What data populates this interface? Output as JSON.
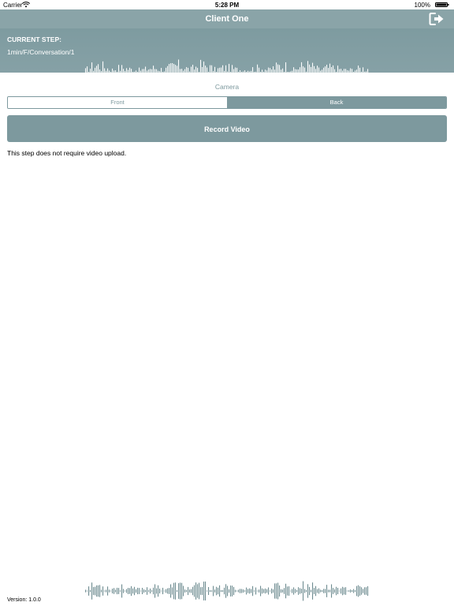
{
  "status_bar": {
    "carrier": "Carrier",
    "time": "5:28 PM",
    "battery": "100%"
  },
  "nav": {
    "title": "Client One",
    "logout_icon": "logout-icon"
  },
  "step": {
    "heading": "CURRENT STEP:",
    "value": "1min/F/Conversation/1"
  },
  "camera": {
    "label": "Camera",
    "options": [
      "Front",
      "Back"
    ],
    "selected": "Back"
  },
  "record_button": "Record Video",
  "info": "This step does not require video upload.",
  "version": "Version: 1.0.0",
  "colors": {
    "accent": "#7d999e",
    "nav": "#8aa4a8",
    "wave_top": "#ffffff",
    "wave_bottom": "#6f8c91"
  }
}
